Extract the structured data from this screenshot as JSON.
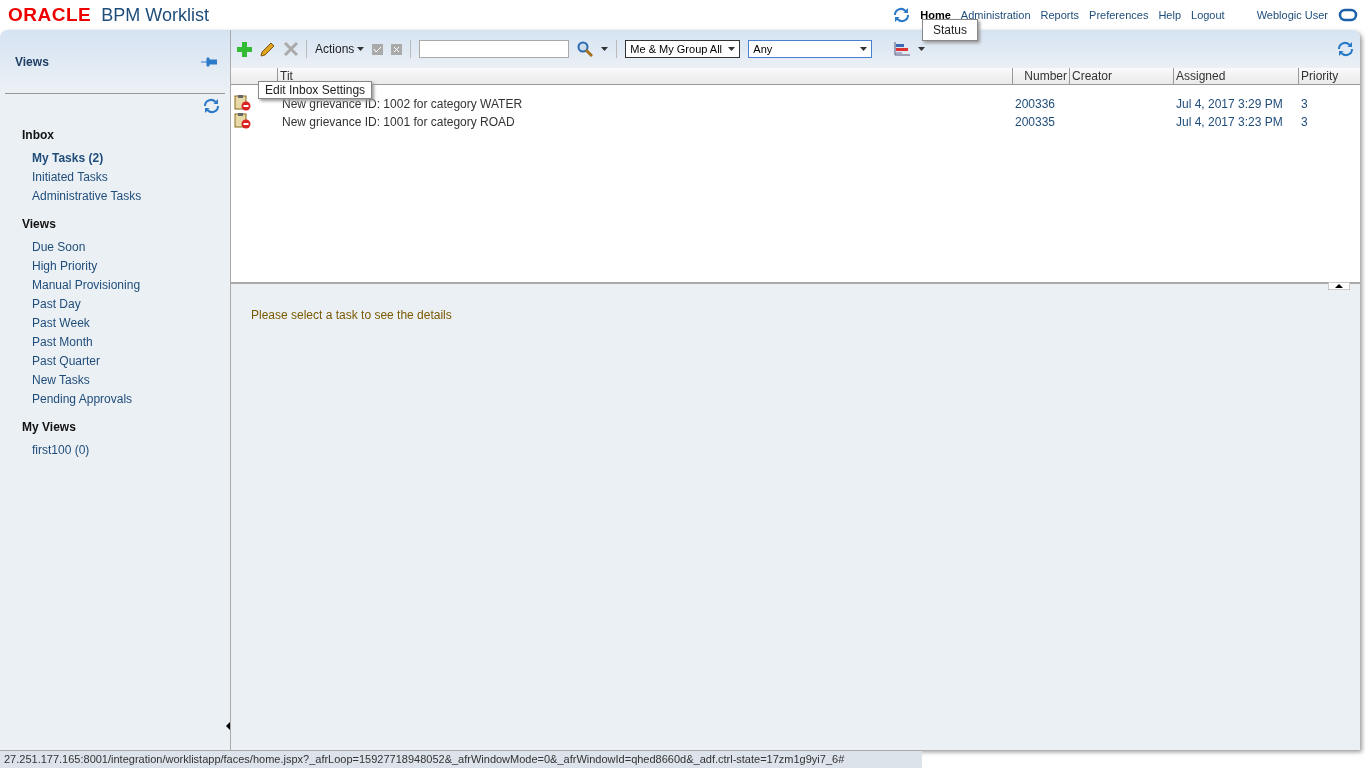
{
  "header": {
    "brand": "ORACLE",
    "app_title": "BPM Worklist",
    "nav": [
      {
        "label": "Home",
        "selected": true
      },
      {
        "label": "Administration",
        "selected": false
      },
      {
        "label": "Reports",
        "selected": false
      },
      {
        "label": "Preferences",
        "selected": false
      },
      {
        "label": "Help",
        "selected": false
      },
      {
        "label": "Logout",
        "selected": false
      }
    ],
    "user": "Weblogic User"
  },
  "sidebar": {
    "title": "Views",
    "sections": [
      {
        "heading": "Inbox",
        "items": [
          {
            "label": "My Tasks (2)",
            "selected": true
          },
          {
            "label": "Initiated Tasks",
            "selected": false
          },
          {
            "label": "Administrative Tasks",
            "selected": false
          }
        ]
      },
      {
        "heading": "Views",
        "items": [
          {
            "label": "Due Soon",
            "selected": false
          },
          {
            "label": "High Priority",
            "selected": false
          },
          {
            "label": "Manual Provisioning",
            "selected": false
          },
          {
            "label": "Past Day",
            "selected": false
          },
          {
            "label": "Past Week",
            "selected": false
          },
          {
            "label": "Past Month",
            "selected": false
          },
          {
            "label": "Past Quarter",
            "selected": false
          },
          {
            "label": "New Tasks",
            "selected": false
          },
          {
            "label": "Pending Approvals",
            "selected": false
          }
        ]
      },
      {
        "heading": "My Views",
        "items": [
          {
            "label": "first100 (0)",
            "selected": false
          }
        ]
      }
    ]
  },
  "toolbar": {
    "actions": "Actions",
    "assignee": "Me & My Group All",
    "status": "Any"
  },
  "tooltips": {
    "edit": "Edit Inbox Settings",
    "status": "Status"
  },
  "table": {
    "columns": [
      "Tit",
      "Number",
      "Creator",
      "Assigned",
      "Priority"
    ],
    "rows": [
      {
        "title": "New grievance ID: 1002 for category WATER",
        "number": "200336",
        "assigned": "Jul 4, 2017 3:29 PM",
        "priority": "3"
      },
      {
        "title": "New grievance ID: 1001 for category ROAD",
        "number": "200335",
        "assigned": "Jul 4, 2017 3:23 PM",
        "priority": "3"
      }
    ]
  },
  "details": {
    "message": "Please select a task to see the details"
  },
  "status_bar": "27.251.177.165:8001/integration/worklistapp/faces/home.jspx?_afrLoop=15927718948052&_afrWindowMode=0&_afrWindowId=qhed8660d&_adf.ctrl-state=17zm1g9yi7_6#"
}
